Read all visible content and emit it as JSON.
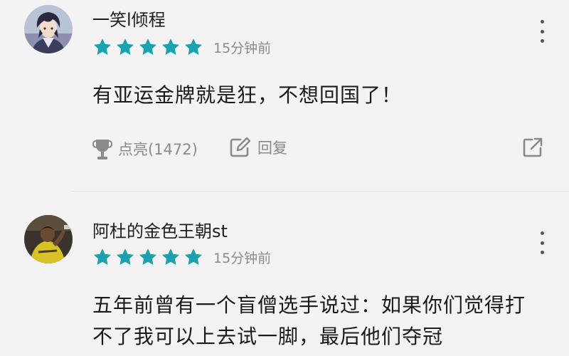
{
  "colors": {
    "background": "#f3f3f3",
    "star": "#1ba2b0",
    "muted_text": "#8a8a8a",
    "divider": "#e2e2e2"
  },
  "comments": [
    {
      "username": "一笑l倾程",
      "rating": 5,
      "time": "15分钟前",
      "content": "有亚运金牌就是狂，不想回国了！",
      "like_label": "点亮(1472)",
      "reply_label": "回复"
    },
    {
      "username": "阿杜的金色王朝st",
      "rating": 5,
      "time": "15分钟前",
      "content": "五年前曾有一个盲僧选手说过：如果你们觉得打不了我可以上去试一脚，最后他们夺冠"
    }
  ],
  "icons": {
    "more": "more-vertical-icon",
    "like": "trophy-icon",
    "reply": "edit-reply-icon",
    "share": "share-icon",
    "star": "star-icon"
  }
}
